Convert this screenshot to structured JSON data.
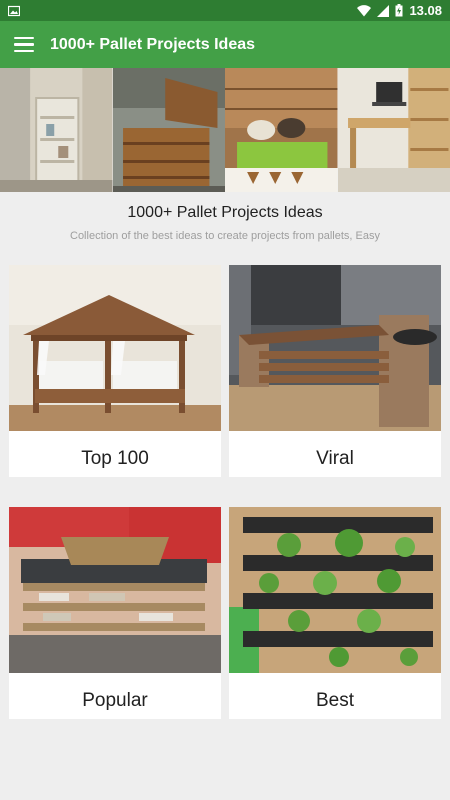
{
  "status": {
    "time": "13.08"
  },
  "app_bar": {
    "title": "1000+ Pallet Projects Ideas",
    "menu_icon": "hamburger-menu-icon"
  },
  "header": {
    "title": "1000+ Pallet Projects Ideas",
    "subtitle": "Collection of the best ideas to create projects from pallets, Easy"
  },
  "categories": [
    {
      "label": "Top 100"
    },
    {
      "label": "Viral"
    },
    {
      "label": "Popular"
    },
    {
      "label": "Best"
    }
  ],
  "colors": {
    "status_bar": "#2e7d32",
    "app_bar": "#43a047",
    "background": "#eeeeee"
  }
}
